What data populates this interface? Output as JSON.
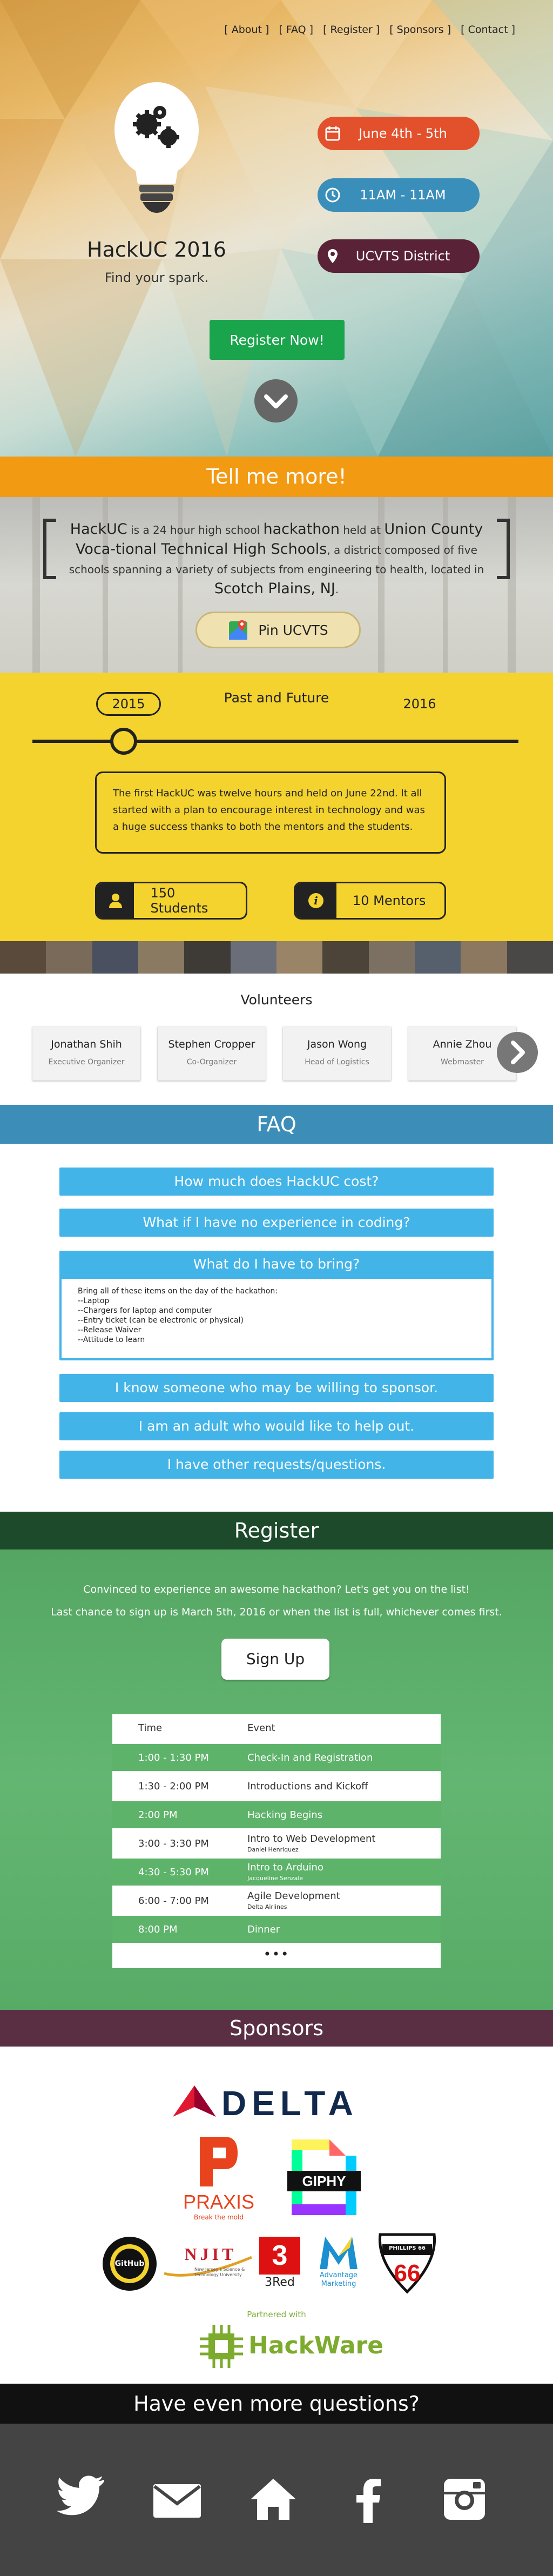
{
  "nav": {
    "items": [
      "[ About ]",
      "[ FAQ ]",
      "[ Register ]",
      "[ Sponsors ]",
      "[ Contact ]"
    ]
  },
  "hero": {
    "title": "HackUC 2016",
    "tagline": "Find your spark.",
    "date": "June 4th - 5th",
    "time": "11AM - 11AM",
    "location": "UCVTS District",
    "register_label": "Register Now!",
    "colors": {
      "date": "#e3502c",
      "time": "#3a8eba",
      "location": "#5a2236",
      "register": "#1aa44c"
    }
  },
  "about": {
    "heading": "Tell me more!",
    "p1": "HackUC",
    "p2": " is a 24 hour high school ",
    "p3": "hackathon",
    "p4": " held at ",
    "p5": "Union County Voca-tional Technical High Schools",
    "p6": ", a district composed of five schools spanning a variety of subjects from engineering to health, located in ",
    "p7": "Scotch Plains, NJ",
    "p8": ".",
    "pin_label": "Pin UCVTS"
  },
  "past": {
    "year_left": "2015",
    "title": "Past and Future",
    "year_right": "2016",
    "text": "The first HackUC was twelve hours and held on June 22nd. It all started with a plan to encourage interest in technology and was a huge success thanks to both the mentors and the students.",
    "students": "150 Students",
    "mentors": "10 Mentors"
  },
  "volunteers": {
    "title": "Volunteers",
    "people": [
      {
        "name": "Jonathan Shih",
        "role": "Executive Organizer"
      },
      {
        "name": "Stephen Cropper",
        "role": "Co-Organizer"
      },
      {
        "name": "Jason Wong",
        "role": "Head of Logistics"
      },
      {
        "name": "Annie Zhou",
        "role": "Webmaster"
      }
    ]
  },
  "faq": {
    "heading": "FAQ",
    "q1": "How much does HackUC cost?",
    "q2": "What if I have no experience in coding?",
    "q3": "What do I have to bring?",
    "a3": [
      "Bring all of these items on the day of the hackathon:",
      "--Laptop",
      "--Chargers for laptop and computer",
      "--Entry ticket (can be electronic or physical)",
      "--Release Waiver",
      "--Attitude to learn"
    ],
    "q4": "I know someone who may be willing to sponsor.",
    "q5": "I am an adult who would like to help out.",
    "q6": "I have other requests/questions."
  },
  "register": {
    "heading": "Register",
    "line1": "Convinced to experience an awesome hackathon? Let's get you on the list!",
    "line2": "Last chance to sign up is March 5th, 2016 or when the list is full, whichever comes first.",
    "signup_label": "Sign Up",
    "col_time": "Time",
    "col_event": "Event",
    "rows": [
      {
        "time": "1:00 - 1:30 PM",
        "event": "Check-In and Registration",
        "sub": ""
      },
      {
        "time": "1:30 - 2:00 PM",
        "event": "Introductions and Kickoff",
        "sub": ""
      },
      {
        "time": "2:00 PM",
        "event": "Hacking Begins",
        "sub": ""
      },
      {
        "time": "3:00 - 3:30 PM",
        "event": "Intro to Web Development",
        "sub": "Daniel Henriquez"
      },
      {
        "time": "4:30 - 5:30 PM",
        "event": "Intro to Arduino",
        "sub": "Jacqueline Senzale"
      },
      {
        "time": "6:00 - 7:00 PM",
        "event": "Agile Development",
        "sub": "Delta Airlines"
      },
      {
        "time": "8:00 PM",
        "event": "Dinner",
        "sub": ""
      }
    ],
    "more": "•••"
  },
  "sponsors": {
    "heading": "Sponsors",
    "delta": "DELTA",
    "praxis": "PRAXIS",
    "praxis_sub": "Break the mold",
    "giphy": "GIPHY",
    "github": "GitHub",
    "njit": "NJIT",
    "njit_sub": "New Jersey's Science & Technology University",
    "threered": "3Red",
    "advantage": "Advantage Marketing",
    "phillips": "PHILLIPS 66",
    "partnered": "Partnered with",
    "hackware": "HackWare"
  },
  "contact": {
    "heading": "Have even more questions?"
  }
}
